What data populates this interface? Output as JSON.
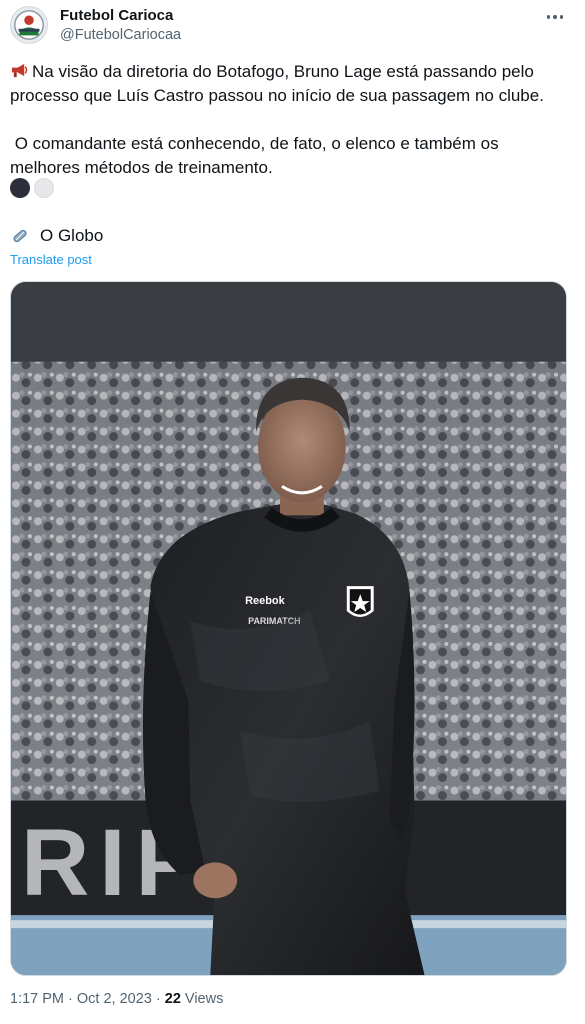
{
  "author": {
    "name": "Futebol Carioca",
    "handle": "@FutebolCariocaa"
  },
  "post": {
    "line1": "Na visão da diretoria do Botafogo, Bruno Lage está passando pelo processo que Luís Castro passou no início de sua passagem no clube.",
    "line2": " O comandante está conhecendo, de fato, o elenco e também os melhores métodos de treinamento.",
    "source_label": "O Globo",
    "translate": "Translate post"
  },
  "meta": {
    "time": "1:17 PM",
    "separator1": " · ",
    "date": "Oct 2, 2023",
    "separator2": " · ",
    "views_count": "22",
    "views_label": " Views"
  },
  "colors": {
    "accent": "#1d9bf0",
    "text": "#0f1419",
    "secondary": "#536471"
  },
  "icons": {
    "post_lead": "megaphone-icon",
    "source": "clip-icon",
    "more": "more-icon"
  }
}
